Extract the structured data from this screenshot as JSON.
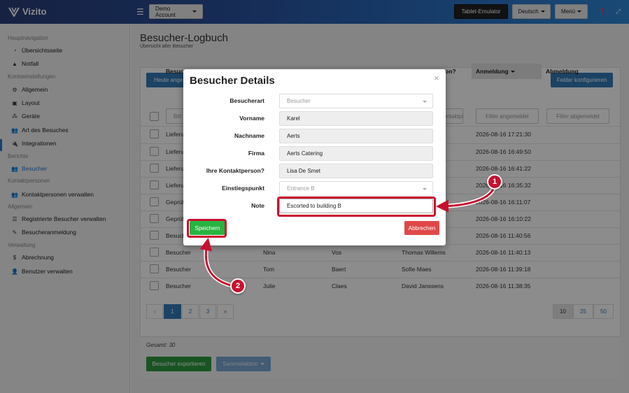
{
  "app": {
    "name": "Vizito"
  },
  "topbar": {
    "account_label": "Demo Account",
    "tablet_label": "Tablet-Emulator",
    "language_label": "Deutsch",
    "menu_label": "Menü",
    "help_icon": "help-icon",
    "expand_icon": "expand-icon"
  },
  "sidebar": {
    "sections": [
      {
        "label": "Hauptnavigation",
        "items": [
          {
            "label": "Übersichtsseite",
            "icon": "dashboard-icon"
          },
          {
            "label": "Notfall",
            "icon": "warning-icon"
          }
        ]
      },
      {
        "label": "Kontoeinstellungen",
        "items": [
          {
            "label": "Allgemein",
            "icon": "gear-icon"
          },
          {
            "label": "Layout",
            "icon": "image-icon"
          },
          {
            "label": "Geräte",
            "icon": "devices-icon"
          },
          {
            "label": "Art des Besuches",
            "icon": "users-icon"
          },
          {
            "label": "Integrationen",
            "icon": "plug-icon"
          }
        ]
      },
      {
        "label": "Berichte",
        "items": [
          {
            "label": "Besucher",
            "icon": "users-icon",
            "active": true
          }
        ]
      },
      {
        "label": "Kontaktpersonen",
        "items": [
          {
            "label": "Kontaktpersonen verwalten",
            "icon": "users-icon"
          }
        ]
      },
      {
        "label": "Allgemein",
        "items": [
          {
            "label": "Registrierte Besucher verwalten",
            "icon": "list-icon"
          },
          {
            "label": "Besucheranmeldung",
            "icon": "pencil-icon"
          }
        ]
      },
      {
        "label": "Verwaltung",
        "items": [
          {
            "label": "Abrechnung",
            "icon": "dollar-icon"
          },
          {
            "label": "Benutzer verwalten",
            "icon": "user-add-icon"
          }
        ]
      }
    ]
  },
  "page": {
    "title": "Besucher-Logbuch",
    "subtitle": "Übersicht aller Besucher",
    "today_button": "Heute angem",
    "config_button": "Felder konfigurieren",
    "col_first": "Besuch",
    "col_contact_tail": "on?",
    "col_login": "Anmeldung",
    "col_logout": "Abmeldung",
    "filter_first": "Bitt",
    "filter_contact": "ontaktpi",
    "filter_login": "Filter angemeldet",
    "filter_logout": "Filter abgemeldet",
    "rows": [
      {
        "type": "Lieferu",
        "first": "",
        "last": "",
        "contact": "",
        "login": "2026-08-16 17:21:30"
      },
      {
        "type": "Lieferu",
        "first": "",
        "last": "",
        "contact": "",
        "login": "2026-08-16 16:49:50"
      },
      {
        "type": "Lieferu",
        "first": "",
        "last": "",
        "contact": "",
        "login": "2026-08-16 16:41:22"
      },
      {
        "type": "Lieferu",
        "first": "",
        "last": "",
        "contact": "",
        "login": "2026-08-16 16:35:32"
      },
      {
        "type": "Geprüf",
        "first": "",
        "last": "",
        "contact": "",
        "login": "2026-08-16 16:11:07"
      },
      {
        "type": "Geprüf",
        "first": "",
        "last": "",
        "contact": "",
        "login": "2026-08-16 16:10:22"
      },
      {
        "type": "Besuch",
        "first": "",
        "last": "",
        "contact": "",
        "login": "2026-08-16 11:40:56"
      },
      {
        "type": "Besucher",
        "first": "Nina",
        "last": "Vos",
        "contact": "Thomas Willems",
        "login": "2026-08-16 11:40:13"
      },
      {
        "type": "Besucher",
        "first": "Tom",
        "last": "Baert",
        "contact": "Sofie Maes",
        "login": "2026-08-16 11:39:18"
      },
      {
        "type": "Besucher",
        "first": "Julie",
        "last": "Claes",
        "contact": "David Janssens",
        "login": "2026-08-16 11:38:35"
      }
    ],
    "pagination": {
      "prev": "«",
      "pages": [
        "1",
        "2",
        "3"
      ],
      "next": "»"
    },
    "page_sizes": [
      "10",
      "25",
      "50"
    ],
    "total": "Gesamt: 30",
    "export_button": "Besucher exportieren",
    "bulk_button": "Sammelaktion"
  },
  "modal": {
    "title": "Besucher Details",
    "close": "×",
    "fields": [
      {
        "label": "Besucherart",
        "value": "Besucher",
        "kind": "select"
      },
      {
        "label": "Vorname",
        "value": "Karel",
        "kind": "text"
      },
      {
        "label": "Nachname",
        "value": "Aerts",
        "kind": "text"
      },
      {
        "label": "Firma",
        "value": "Aerts Catering",
        "kind": "text"
      },
      {
        "label": "Ihre Kontaktperson?",
        "value": "Lisa De Smet",
        "kind": "text"
      },
      {
        "label": "Einstiegspunkt",
        "value": "Entrance B",
        "kind": "select"
      },
      {
        "label": "Note",
        "value": "Escorted to building B",
        "kind": "note"
      }
    ],
    "save_button": "Speichern",
    "cancel_button": "Abbrechen"
  },
  "annotations": {
    "step1": "1",
    "step2": "2",
    "color": "#c8102e"
  }
}
